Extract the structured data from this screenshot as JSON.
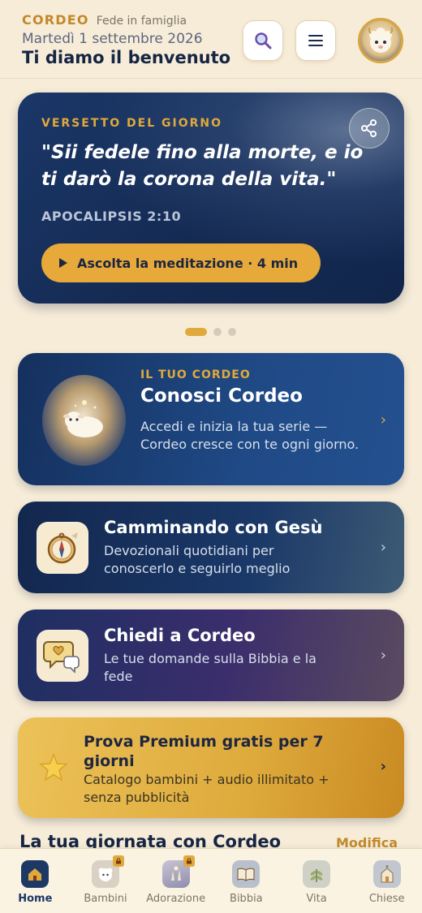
{
  "header": {
    "brand": "CORDEO",
    "tagline": "Fede in famiglia",
    "date": "Martedì 1 settembre 2026",
    "welcome": "Ti diamo il benvenuto"
  },
  "verse": {
    "eyebrow": "VERSETTO DEL GIORNO",
    "text": "\"Sii fedele fino alla morte, e io ti darò la corona della vita.\"",
    "reference": "APOCALIPSIS 2:10",
    "listen_label": "Ascolta la meditazione · 4 min"
  },
  "carousel": {
    "page_count": 3,
    "active_index": 0
  },
  "cards": {
    "cordeo": {
      "eyebrow": "IL TUO CORDEO",
      "title": "Conosci Cordeo",
      "desc": "Accedi e inizia la tua serie — Cordeo cresce con te ogni giorno.",
      "chevron": "›"
    },
    "gesu": {
      "title": "Camminando con Gesù",
      "desc": "Devozionali quotidiani per conoscerlo e seguirlo meglio",
      "chevron": "›"
    },
    "chiedi": {
      "title": "Chiedi a Cordeo",
      "desc": "Le tue domande sulla Bibbia e la fede",
      "chevron": "›"
    },
    "premium": {
      "title": "Prova Premium gratis per 7 giorni",
      "desc": "Catalogo bambini + audio illimitato + senza pubblicità",
      "chevron": "›"
    }
  },
  "section": {
    "title": "La tua giornata con Cordeo",
    "edit_label": "Modifica"
  },
  "tabs": [
    {
      "label": "Home",
      "icon": "home-icon",
      "active": true,
      "locked": false
    },
    {
      "label": "Bambini",
      "icon": "lamb-icon",
      "active": false,
      "locked": true
    },
    {
      "label": "Adorazione",
      "icon": "worship-icon",
      "active": false,
      "locked": true
    },
    {
      "label": "Bibbia",
      "icon": "bible-icon",
      "active": false,
      "locked": false
    },
    {
      "label": "Vita",
      "icon": "leaf-icon",
      "active": false,
      "locked": false
    },
    {
      "label": "Chiese",
      "icon": "church-icon",
      "active": false,
      "locked": false
    }
  ],
  "colors": {
    "background": "#f7ecd8",
    "accent_gold": "#e0a93b",
    "navy": "#152544"
  }
}
